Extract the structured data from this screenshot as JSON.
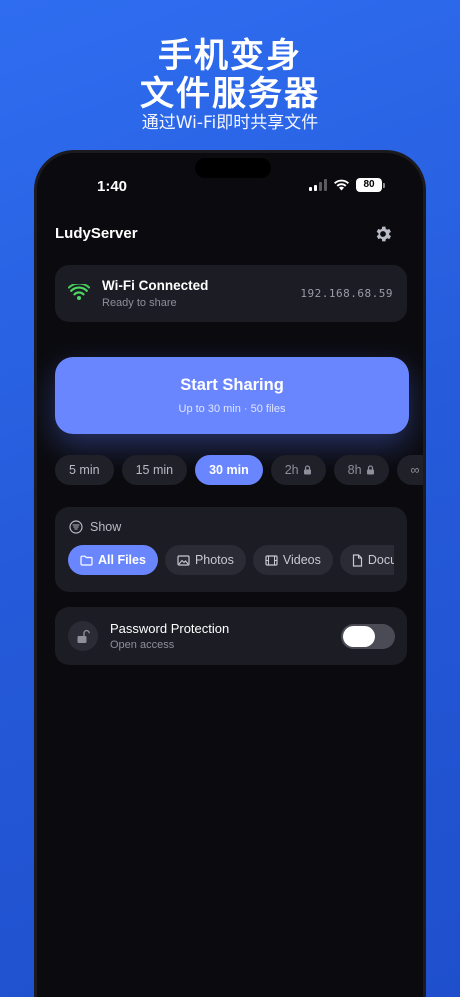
{
  "promo": {
    "title_line1": "手机变身",
    "title_line2": "文件服务器",
    "subtitle": "通过Wi-Fi即时共享文件"
  },
  "status_bar": {
    "time": "1:40",
    "battery": "80"
  },
  "app": {
    "title": "LudyServer",
    "settings_icon": "gear-icon"
  },
  "wifi_card": {
    "title": "Wi-Fi Connected",
    "subtitle": "Ready to share",
    "ip": "192.168.68.59",
    "icon": "wifi-icon",
    "icon_color": "#4cd964"
  },
  "start_button": {
    "label": "Start Sharing",
    "sublabel": "Up to 30 min · 50 files"
  },
  "durations": [
    {
      "label": "5 min",
      "locked": false,
      "active": false
    },
    {
      "label": "15 min",
      "locked": false,
      "active": false
    },
    {
      "label": "30 min",
      "locked": false,
      "active": true
    },
    {
      "label": "2h",
      "locked": true,
      "active": false
    },
    {
      "label": "8h",
      "locked": true,
      "active": false
    },
    {
      "label": "∞",
      "locked": true,
      "active": false
    }
  ],
  "show_filter": {
    "label": "Show",
    "options": [
      {
        "label": "All Files",
        "icon": "folder-icon",
        "active": true
      },
      {
        "label": "Photos",
        "icon": "image-icon",
        "active": false
      },
      {
        "label": "Videos",
        "icon": "film-icon",
        "active": false
      },
      {
        "label": "Documents",
        "icon": "document-icon",
        "active": false
      }
    ]
  },
  "password": {
    "title": "Password Protection",
    "subtitle": "Open access",
    "icon": "unlock-icon",
    "enabled": false
  },
  "colors": {
    "accent": "#6a86ff",
    "background": "#2459d8",
    "card": "#1b1c24",
    "screen": "#0b0b0f"
  }
}
